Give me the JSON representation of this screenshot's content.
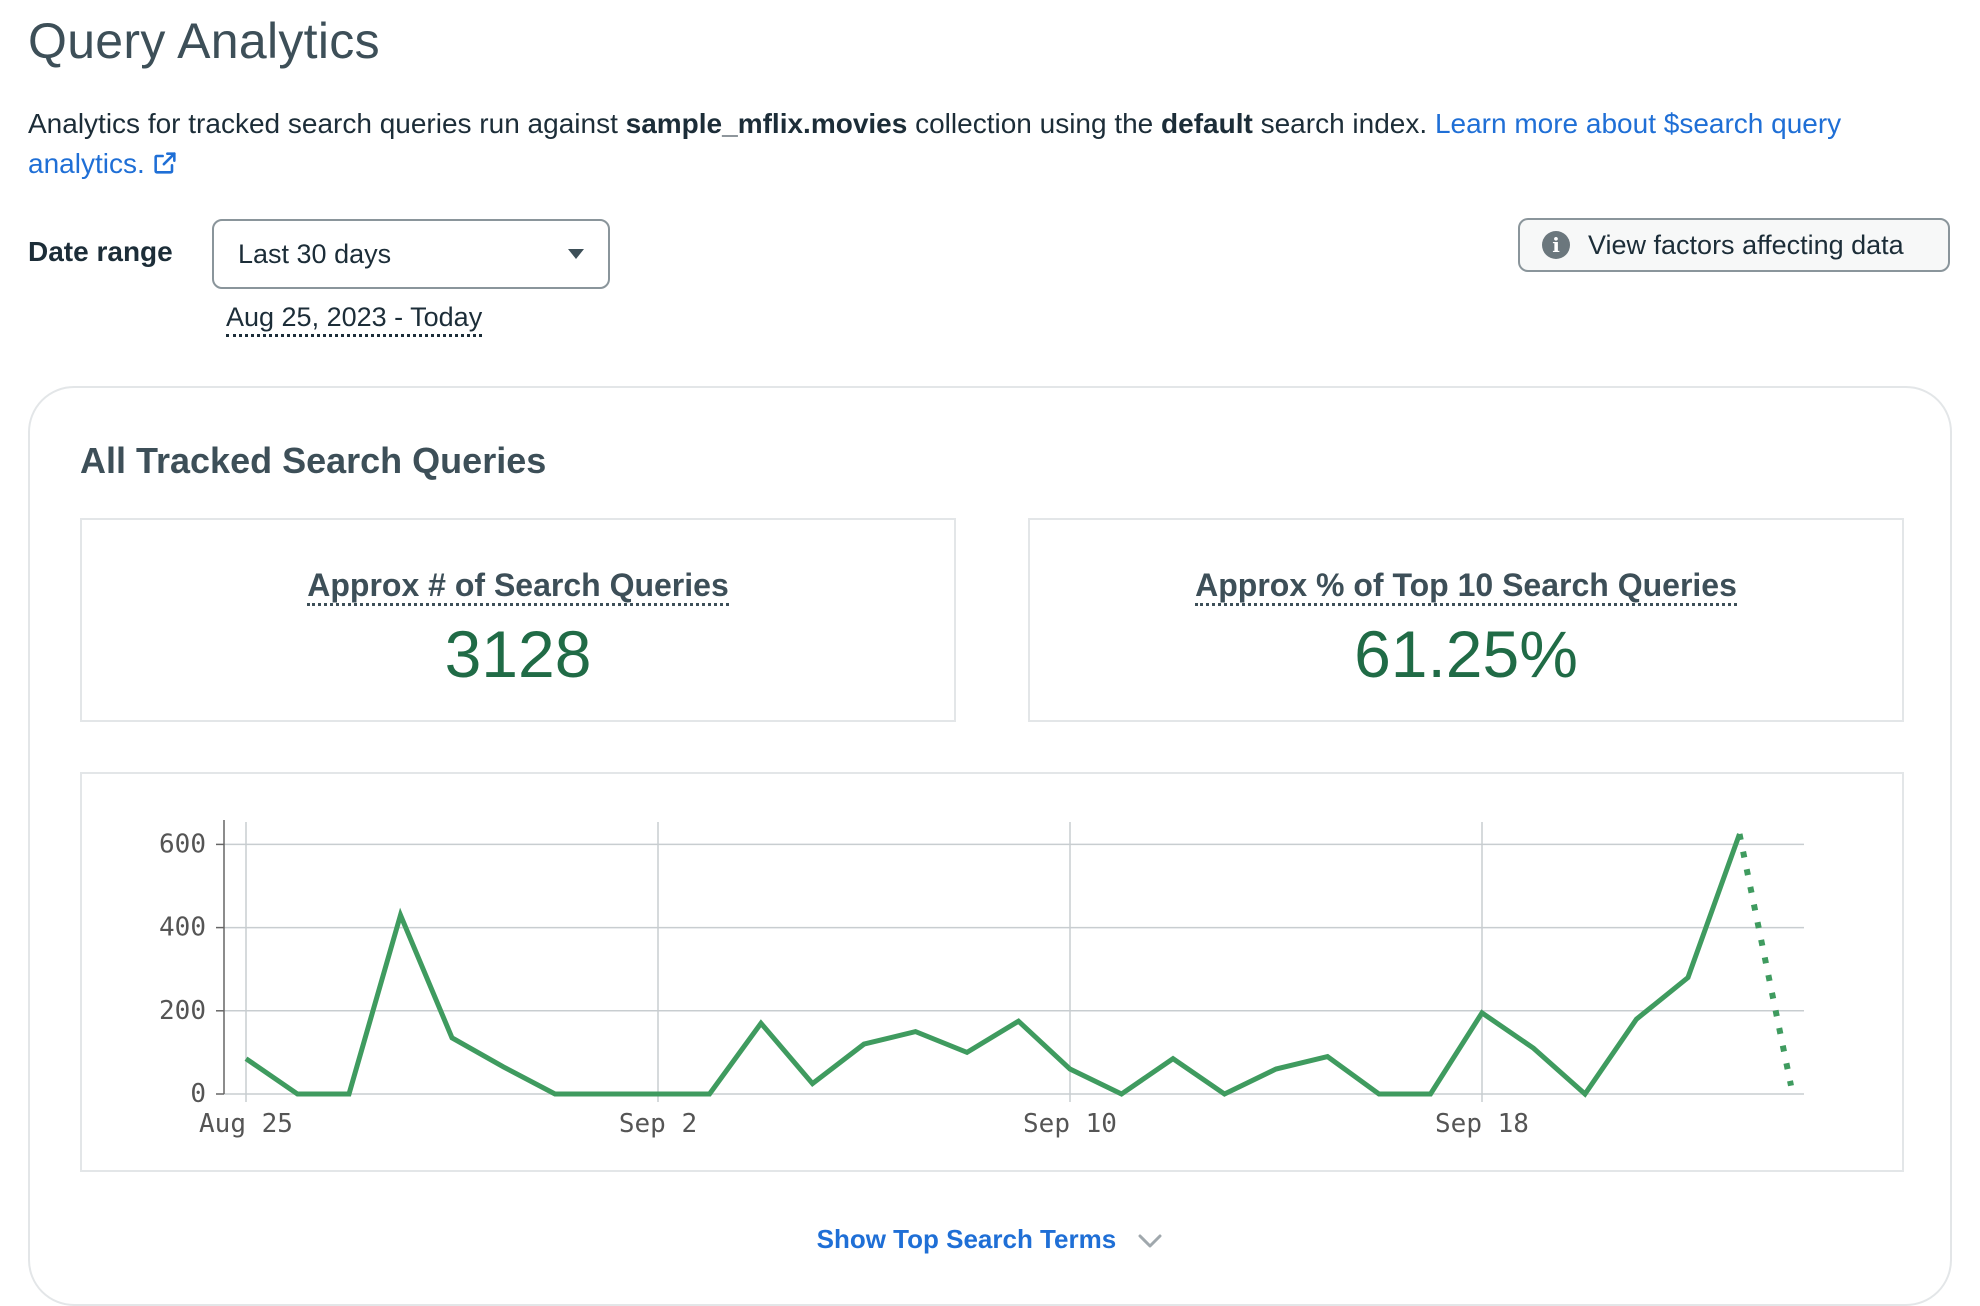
{
  "page": {
    "title": "Query Analytics",
    "description": {
      "prefix": "Analytics for tracked search queries run against ",
      "collection": "sample_mflix.movies",
      "middle": " collection using the ",
      "index": "default",
      "suffix": " search index. ",
      "link_text": "Learn more about $search query analytics."
    }
  },
  "filters": {
    "date_range_label": "Date range",
    "date_range_selected": "Last 30 days",
    "date_range_text": "Aug 25, 2023 - Today",
    "factors_button": "View factors affecting data"
  },
  "card": {
    "title": "All Tracked Search Queries",
    "stat_queries_label": "Approx # of Search Queries",
    "stat_queries_value": "3128",
    "stat_top10_label": "Approx % of Top 10 Search Queries",
    "stat_top10_value": "61.25%",
    "show_terms": "Show Top Search Terms"
  },
  "colors": {
    "accent_link": "#1f6fd6",
    "stat_green": "#206b46",
    "line_green": "#3f9b5f"
  },
  "chart_data": {
    "type": "line",
    "x": [
      "Aug 25",
      "Aug 26",
      "Aug 27",
      "Aug 28",
      "Aug 29",
      "Aug 30",
      "Aug 31",
      "Sep 1",
      "Sep 2",
      "Sep 3",
      "Sep 4",
      "Sep 5",
      "Sep 6",
      "Sep 7",
      "Sep 8",
      "Sep 9",
      "Sep 10",
      "Sep 11",
      "Sep 12",
      "Sep 13",
      "Sep 14",
      "Sep 15",
      "Sep 16",
      "Sep 17",
      "Sep 18",
      "Sep 19",
      "Sep 20",
      "Sep 21",
      "Sep 22",
      "Sep 23",
      "Sep 24"
    ],
    "series": [
      {
        "values": [
          85,
          0,
          0,
          430,
          135,
          65,
          0,
          0,
          0,
          0,
          170,
          25,
          120,
          150,
          100,
          175,
          60,
          0,
          85,
          0,
          60,
          90,
          0,
          0,
          195,
          110,
          0,
          180,
          280,
          625,
          20
        ],
        "dashed_from_index": 29
      }
    ],
    "x_ticks": [
      "Aug 25",
      "Sep 2",
      "Sep 10",
      "Sep 18"
    ],
    "y_ticks": [
      0,
      200,
      400,
      600
    ],
    "ylim": [
      0,
      625
    ],
    "grid": true,
    "legend": "none"
  }
}
